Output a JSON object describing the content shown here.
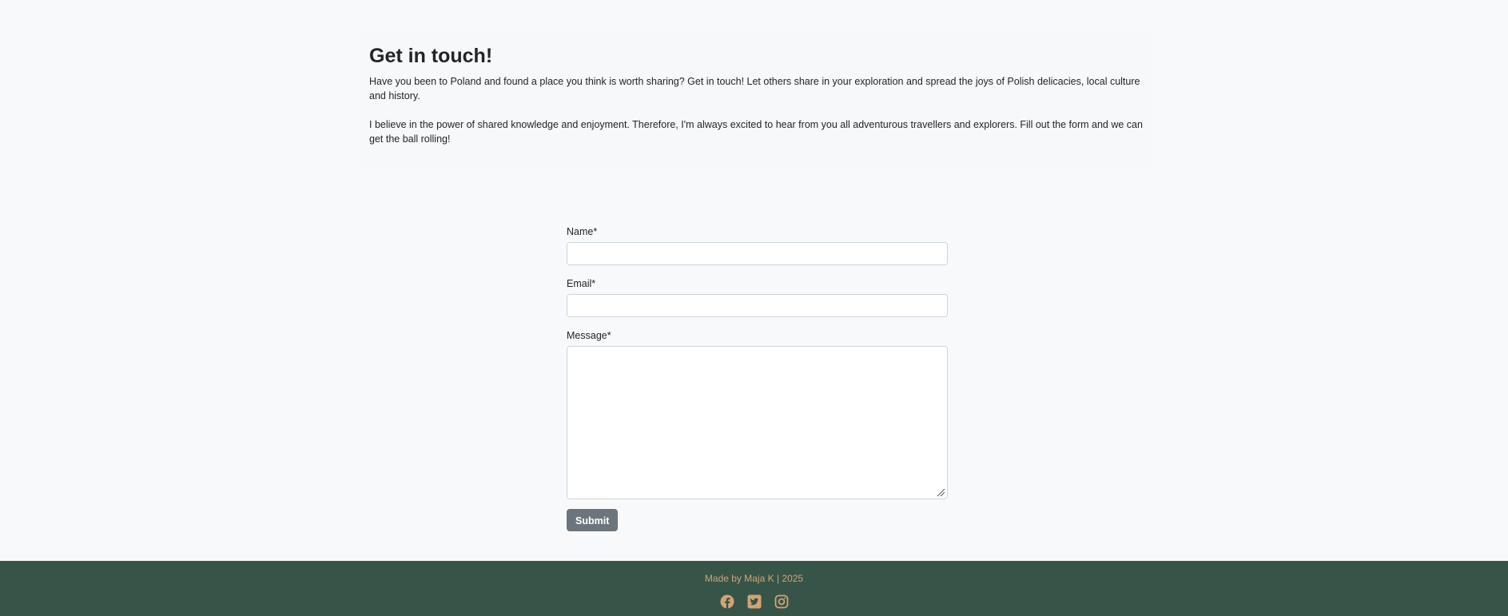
{
  "intro": {
    "title": "Get in touch!",
    "paragraph_1": "Have you been to Poland and found a place you think is worth sharing? Get in touch! Let others share in your exploration and spread the joys of Polish delicacies, local culture and history.",
    "paragraph_2": "I believe in the power of shared knowledge and enjoyment. Therefore, I'm always excited to hear from you all adventurous travellers and explorers. Fill out the form and we can get the ball rolling!"
  },
  "form": {
    "name_label": "Name*",
    "name_value": "",
    "email_label": "Email*",
    "email_value": "",
    "message_label": "Message*",
    "message_value": "",
    "submit_label": "Submit"
  },
  "footer": {
    "credit": "Made by Maja K | 2025",
    "socials": [
      "facebook-icon",
      "twitter-icon",
      "instagram-icon"
    ],
    "accent_color": "#d4a373",
    "background_color": "#375448"
  }
}
